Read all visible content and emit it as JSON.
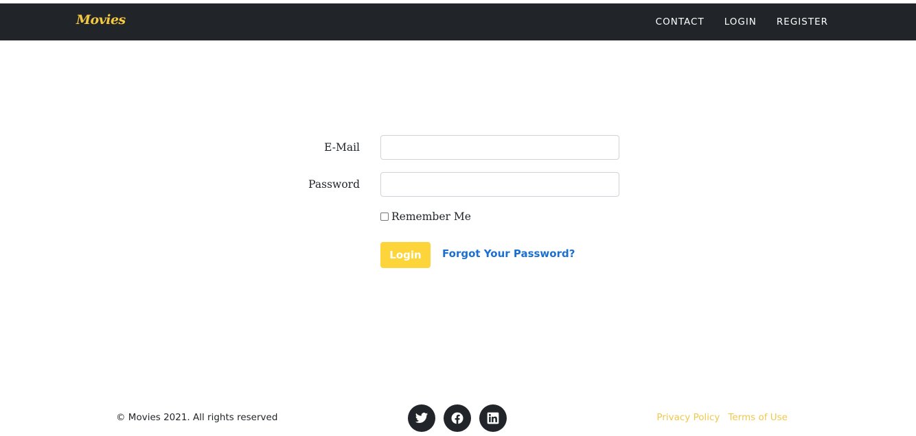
{
  "navbar": {
    "brand": "Movies",
    "links": [
      "CONTACT",
      "LOGIN",
      "REGISTER"
    ]
  },
  "form": {
    "email_label": "E-Mail",
    "email_value": "",
    "password_label": "Password",
    "password_value": "",
    "remember_label": "Remember Me",
    "remember_checked": false,
    "login_label": "Login",
    "forgot_label": "Forgot Your Password?"
  },
  "footer": {
    "copyright": "© Movies 2021. All rights reserved",
    "social_icons": [
      "twitter-icon",
      "facebook-icon",
      "linkedin-icon"
    ],
    "links": [
      "Privacy Policy",
      "Terms of Use"
    ]
  },
  "colors": {
    "navbar_bg": "#212529",
    "accent": "#fdd43a",
    "link": "#1a6fd1"
  }
}
